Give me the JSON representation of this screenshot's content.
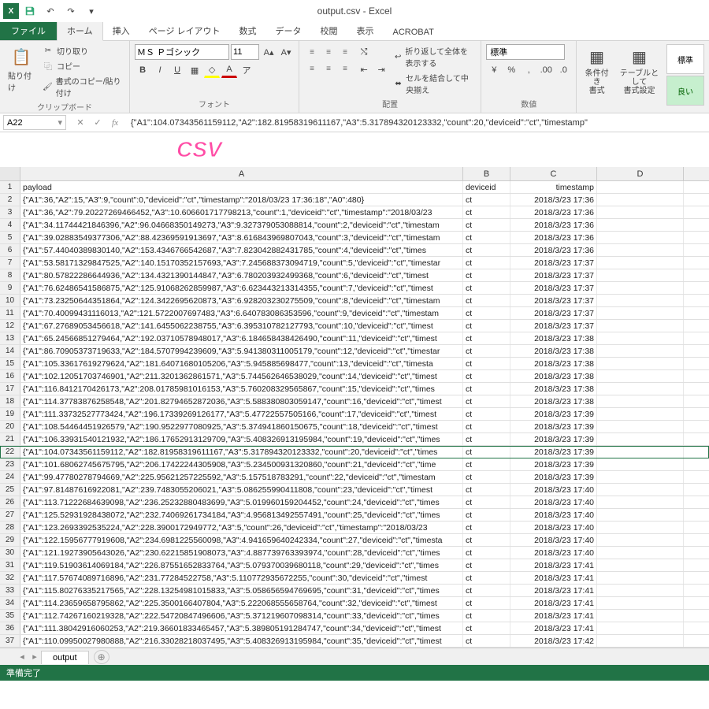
{
  "title": "output.csv - Excel",
  "tabs": {
    "file": "ファイル",
    "home": "ホーム",
    "insert": "挿入",
    "page_layout": "ページ レイアウト",
    "formulas": "数式",
    "data": "データ",
    "review": "校閲",
    "view": "表示",
    "acrobat": "ACROBAT"
  },
  "ribbon": {
    "paste": "貼り付け",
    "cut": "切り取り",
    "copy": "コピー",
    "format_painter": "書式のコピー/貼り付け",
    "clipboard_group": "クリップボード",
    "font_name": "ＭＳ Ｐゴシック",
    "font_size": "11",
    "font_group": "フォント",
    "wrap_text": "折り返して全体を表示する",
    "merge_center": "セルを結合して中央揃え",
    "alignment_group": "配置",
    "number_format": "標準",
    "number_group": "数値",
    "cond_format": "条件付き\n書式",
    "table_format": "テーブルとして\n書式設定",
    "style_normal": "標準",
    "style_good": "良い"
  },
  "namebox": "A22",
  "formula": "{\"A1\":104.07343561159112,\"A2\":182.81958319611167,\"A3\":5.317894320123332,\"count\":20,\"deviceid\":\"ct\",\"timestamp\"",
  "csv_label": "CSV",
  "columns": [
    "A",
    "B",
    "C",
    "D"
  ],
  "headers": {
    "payload": "payload",
    "deviceid": "deviceid",
    "timestamp": "timestamp"
  },
  "rows": [
    {
      "n": 1,
      "a": "payload",
      "b": "deviceid",
      "c": "timestamp"
    },
    {
      "n": 2,
      "a": "{\"A1\":36,\"A2\":15,\"A3\":9,\"count\":0,\"deviceid\":\"ct\",\"timestamp\":\"2018/03/23 17:36:18\",\"A0\":480}",
      "b": "ct",
      "c": "2018/3/23 17:36"
    },
    {
      "n": 3,
      "a": "{\"A1\":36,\"A2\":79.20227269466452,\"A3\":10.606601717798213,\"count\":1,\"deviceid\":\"ct\",\"timestamp\":\"2018/03/23",
      "b": "ct",
      "c": "2018/3/23 17:36"
    },
    {
      "n": 4,
      "a": "{\"A1\":34.11744421846396,\"A2\":96.04668350149273,\"A3\":9.327379053088814,\"count\":2,\"deviceid\":\"ct\",\"timestam",
      "b": "ct",
      "c": "2018/3/23 17:36"
    },
    {
      "n": 5,
      "a": "{\"A1\":39.02883549377306,\"A2\":88.42369591913697,\"A3\":8.616843969807043,\"count\":3,\"deviceid\":\"ct\",\"timestam",
      "b": "ct",
      "c": "2018/3/23 17:36"
    },
    {
      "n": 6,
      "a": "{\"A1\":57.44040389830140,\"A2\":153.4346766542687,\"A3\":7.823042882431785,\"count\":4,\"deviceid\":\"ct\",\"times",
      "b": "ct",
      "c": "2018/3/23 17:36"
    },
    {
      "n": 7,
      "a": "{\"A1\":53.58171329847525,\"A2\":140.15170352157693,\"A3\":7.245688373094719,\"count\":5,\"deviceid\":\"ct\",\"timestar",
      "b": "ct",
      "c": "2018/3/23 17:37"
    },
    {
      "n": 8,
      "a": "{\"A1\":80.57822286644936,\"A2\":134.4321390144847,\"A3\":6.780203932499368,\"count\":6,\"deviceid\":\"ct\",\"timest",
      "b": "ct",
      "c": "2018/3/23 17:37"
    },
    {
      "n": 9,
      "a": "{\"A1\":76.62486541586875,\"A2\":125.91068262859987,\"A3\":6.623443213314355,\"count\":7,\"deviceid\":\"ct\",\"timest",
      "b": "ct",
      "c": "2018/3/23 17:37"
    },
    {
      "n": 10,
      "a": "{\"A1\":73.23250644351864,\"A2\":124.3422695620873,\"A3\":6.928203230275509,\"count\":8,\"deviceid\":\"ct\",\"timestam",
      "b": "ct",
      "c": "2018/3/23 17:37"
    },
    {
      "n": 11,
      "a": "{\"A1\":70.40099431116013,\"A2\":121.5722007697483,\"A3\":6.640783086353596,\"count\":9,\"deviceid\":\"ct\",\"timestam",
      "b": "ct",
      "c": "2018/3/23 17:37"
    },
    {
      "n": 12,
      "a": "{\"A1\":67.27689053456618,\"A2\":141.6455062238755,\"A3\":6.395310782127793,\"count\":10,\"deviceid\":\"ct\",\"timest",
      "b": "ct",
      "c": "2018/3/23 17:37"
    },
    {
      "n": 13,
      "a": "{\"A1\":65.24566851279464,\"A2\":192.03710578948017,\"A3\":6.184658438426490,\"count\":11,\"deviceid\":\"ct\",\"timest",
      "b": "ct",
      "c": "2018/3/23 17:38"
    },
    {
      "n": 14,
      "a": "{\"A1\":86.70905373719633,\"A2\":184.5707994239609,\"A3\":5.941380311005179,\"count\":12,\"deviceid\":\"ct\",\"timestar",
      "b": "ct",
      "c": "2018/3/23 17:38"
    },
    {
      "n": 15,
      "a": "{\"A1\":105.33617619279624,\"A2\":181.64071680105206,\"A3\":5.945885698477,\"count\":13,\"deviceid\":\"ct\",\"timesta",
      "b": "ct",
      "c": "2018/3/23 17:38"
    },
    {
      "n": 16,
      "a": "{\"A1\":102.12051703746901,\"A2\":211.3201362861571,\"A3\":5.744562646538029,\"count\":14,\"deviceid\":\"ct\",\"timest",
      "b": "ct",
      "c": "2018/3/23 17:38"
    },
    {
      "n": 17,
      "a": "{\"A1\":116.8412170426173,\"A2\":208.01785981016153,\"A3\":5.760208329565867,\"count\":15,\"deviceid\":\"ct\",\"times",
      "b": "ct",
      "c": "2018/3/23 17:38"
    },
    {
      "n": 18,
      "a": "{\"A1\":114.37783876258548,\"A2\":201.82794652872036,\"A3\":5.588380803059147,\"count\":16,\"deviceid\":\"ct\",\"timest",
      "b": "ct",
      "c": "2018/3/23 17:38"
    },
    {
      "n": 19,
      "a": "{\"A1\":111.33732527773424,\"A2\":196.17339269126177,\"A3\":5.47722557505166,\"count\":17,\"deviceid\":\"ct\",\"timest",
      "b": "ct",
      "c": "2018/3/23 17:39"
    },
    {
      "n": 20,
      "a": "{\"A1\":108.54464451926579,\"A2\":190.9522977080925,\"A3\":5.374941860150675,\"count\":18,\"deviceid\":\"ct\",\"timest",
      "b": "ct",
      "c": "2018/3/23 17:39"
    },
    {
      "n": 21,
      "a": "{\"A1\":106.33931540121932,\"A2\":186.17652913129709,\"A3\":5.408326913195984,\"count\":19,\"deviceid\":\"ct\",\"times",
      "b": "ct",
      "c": "2018/3/23 17:39"
    },
    {
      "n": 22,
      "a": "{\"A1\":104.07343561159112,\"A2\":182.81958319611167,\"A3\":5.317894320123332,\"count\":20,\"deviceid\":\"ct\",\"times",
      "b": "ct",
      "c": "2018/3/23 17:39",
      "selected": true
    },
    {
      "n": 23,
      "a": "{\"A1\":101.68062745675795,\"A2\":206.17422244305908,\"A3\":5.234500931320860,\"count\":21,\"deviceid\":\"ct\",\"time",
      "b": "ct",
      "c": "2018/3/23 17:39"
    },
    {
      "n": 24,
      "a": "{\"A1\":99.47780278794669,\"A2\":225.95621257225592,\"A3\":5.157518783291,\"count\":22,\"deviceid\":\"ct\",\"timestam",
      "b": "ct",
      "c": "2018/3/23 17:39"
    },
    {
      "n": 25,
      "a": "{\"A1\":97.81487616922081,\"A2\":239.7483055206021,\"A3\":5.086255990411808,\"count\":23,\"deviceid\":\"ct\",\"timest",
      "b": "ct",
      "c": "2018/3/23 17:40"
    },
    {
      "n": 26,
      "a": "{\"A1\":113.71222684639098,\"A2\":236.25232880483699,\"A3\":5.019960159204452,\"count\":24,\"deviceid\":\"ct\",\"times",
      "b": "ct",
      "c": "2018/3/23 17:40"
    },
    {
      "n": 27,
      "a": "{\"A1\":125.52931928438072,\"A2\":232.74069261734184,\"A3\":4.956813492557491,\"count\":25,\"deviceid\":\"ct\",\"times",
      "b": "ct",
      "c": "2018/3/23 17:40"
    },
    {
      "n": 28,
      "a": "{\"A1\":123.2693392535224,\"A2\":228.3900172949772,\"A3\":5,\"count\":26,\"deviceid\":\"ct\",\"timestamp\":\"2018/03/23",
      "b": "ct",
      "c": "2018/3/23 17:40"
    },
    {
      "n": 29,
      "a": "{\"A1\":122.15956777919608,\"A2\":234.6981225560098,\"A3\":4.941659640242334,\"count\":27,\"deviceid\":\"ct\",\"timesta",
      "b": "ct",
      "c": "2018/3/23 17:40"
    },
    {
      "n": 30,
      "a": "{\"A1\":121.19273905643026,\"A2\":230.62215851908073,\"A3\":4.887739763393974,\"count\":28,\"deviceid\":\"ct\",\"times",
      "b": "ct",
      "c": "2018/3/23 17:40"
    },
    {
      "n": 31,
      "a": "{\"A1\":119.51903614069184,\"A2\":226.87551652833764,\"A3\":5.079370039680118,\"count\":29,\"deviceid\":\"ct\",\"times",
      "b": "ct",
      "c": "2018/3/23 17:41"
    },
    {
      "n": 32,
      "a": "{\"A1\":117.57674089716896,\"A2\":231.77284522758,\"A3\":5.110772935672255,\"count\":30,\"deviceid\":\"ct\",\"timest",
      "b": "ct",
      "c": "2018/3/23 17:41"
    },
    {
      "n": 33,
      "a": "{\"A1\":115.80276335217565,\"A2\":228.13254981015833,\"A3\":5.058656594769695,\"count\":31,\"deviceid\":\"ct\",\"times",
      "b": "ct",
      "c": "2018/3/23 17:41"
    },
    {
      "n": 34,
      "a": "{\"A1\":114.23659658795862,\"A2\":225.3500166407804,\"A3\":5.222068555658764,\"count\":32,\"deviceid\":\"ct\",\"timest",
      "b": "ct",
      "c": "2018/3/23 17:41"
    },
    {
      "n": 35,
      "a": "{\"A1\":112.74267160219328,\"A2\":222.54720847496606,\"A3\":5.371219607098314,\"count\":33,\"deviceid\":\"ct\",\"times",
      "b": "ct",
      "c": "2018/3/23 17:41"
    },
    {
      "n": 36,
      "a": "{\"A1\":111.38042916060253,\"A2\":219.36601833465457,\"A3\":5.389805191284747,\"count\":34,\"deviceid\":\"ct\",\"timest",
      "b": "ct",
      "c": "2018/3/23 17:41"
    },
    {
      "n": 37,
      "a": "{\"A1\":110.09950027980888,\"A2\":216.33028218037495,\"A3\":5.408326913195984,\"count\":35,\"deviceid\":\"ct\",\"timest",
      "b": "ct",
      "c": "2018/3/23 17:42"
    }
  ],
  "sheet_tab": "output",
  "status": "準備完了"
}
